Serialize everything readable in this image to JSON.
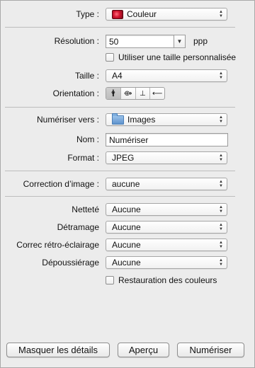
{
  "type": {
    "label": "Type :",
    "value": "Couleur"
  },
  "resolution": {
    "label": "Résolution :",
    "value": "50",
    "unit": "ppp"
  },
  "custom_size": {
    "label": "Utiliser une taille personnalisée",
    "checked": false
  },
  "size": {
    "label": "Taille :",
    "value": "A4"
  },
  "orientation": {
    "label": "Orientation :",
    "glyphs": [
      "🛉",
      "⟴",
      "⊥",
      "⟵"
    ]
  },
  "scan_to": {
    "label": "Numériser vers :",
    "value": "Images"
  },
  "name": {
    "label": "Nom :",
    "value": "Numériser"
  },
  "format": {
    "label": "Format :",
    "value": "JPEG"
  },
  "image_correction": {
    "label": "Correction d’image :",
    "value": "aucune"
  },
  "sharpness": {
    "label": "Netteté",
    "value": "Aucune"
  },
  "descreen": {
    "label": "Détramage",
    "value": "Aucune"
  },
  "backlight": {
    "label": "Correc rétro-éclairage",
    "value": "Aucune"
  },
  "dust": {
    "label": "Dépoussiérage",
    "value": "Aucune"
  },
  "color_restore": {
    "label": "Restauration des couleurs",
    "checked": false
  },
  "buttons": {
    "hide_details": "Masquer les détails",
    "preview": "Aperçu",
    "scan": "Numériser"
  },
  "arrows": {
    "up": "▲",
    "down": "▼"
  },
  "colors": {
    "panel_bg": "#ececec",
    "folder_blue": "#5f93cd",
    "swatch_red": "#d0132d"
  }
}
